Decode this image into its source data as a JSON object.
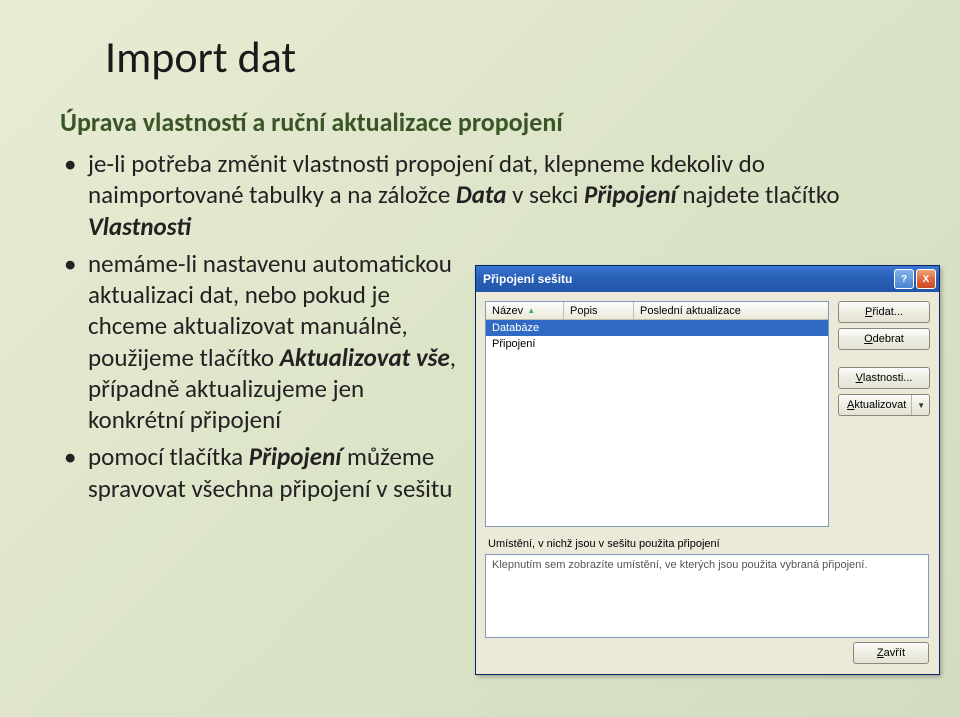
{
  "slide": {
    "title": "Import dat",
    "subtitle": "Úprava vlastností a ruční aktualizace propojení",
    "bullets": [
      {
        "pre": "je-li potřeba změnit vlastnosti propojení dat, klepneme kdekoliv do naimportované tabulky a na záložce ",
        "em1": "Data",
        "mid": " v sekci ",
        "em2": "Připojení",
        "mid2": " najdete tlačítko ",
        "em3": "Vlastnosti",
        "post": ""
      },
      {
        "pre": "nemáme-li nastavenu automatickou aktualizaci dat, nebo pokud je chceme aktualizovat manuálně, použijeme tlačítko ",
        "em1": "Aktualizovat vše",
        "mid": ", případně aktualizujeme jen konkrétní připojení",
        "em2": "",
        "mid2": "",
        "em3": "",
        "post": ""
      },
      {
        "pre": "pomocí tlačítka ",
        "em1": "Připojení",
        "mid": " můžeme spravovat všechna připojení v sešitu",
        "em2": "",
        "mid2": "",
        "em3": "",
        "post": ""
      }
    ]
  },
  "dialog": {
    "title": "Připojení sešitu",
    "help": "?",
    "close_x": "X",
    "columns": {
      "name": "Název",
      "desc": "Popis",
      "last": "Poslední aktualizace"
    },
    "rows": [
      {
        "name": "Databáze",
        "desc": "",
        "last": "",
        "selected": true
      },
      {
        "name": "Připojení",
        "desc": "",
        "last": "",
        "selected": false
      }
    ],
    "buttons": {
      "add": "Přidat...",
      "remove": "Odebrat",
      "props": "Vlastnosti...",
      "refresh": "Aktualizovat"
    },
    "loc_label": "Umístění, v nichž jsou v sešitu použita připojení",
    "loc_hint": "Klepnutím sem zobrazíte umístění, ve kterých jsou použita vybraná připojení.",
    "close": "Zavřít"
  }
}
